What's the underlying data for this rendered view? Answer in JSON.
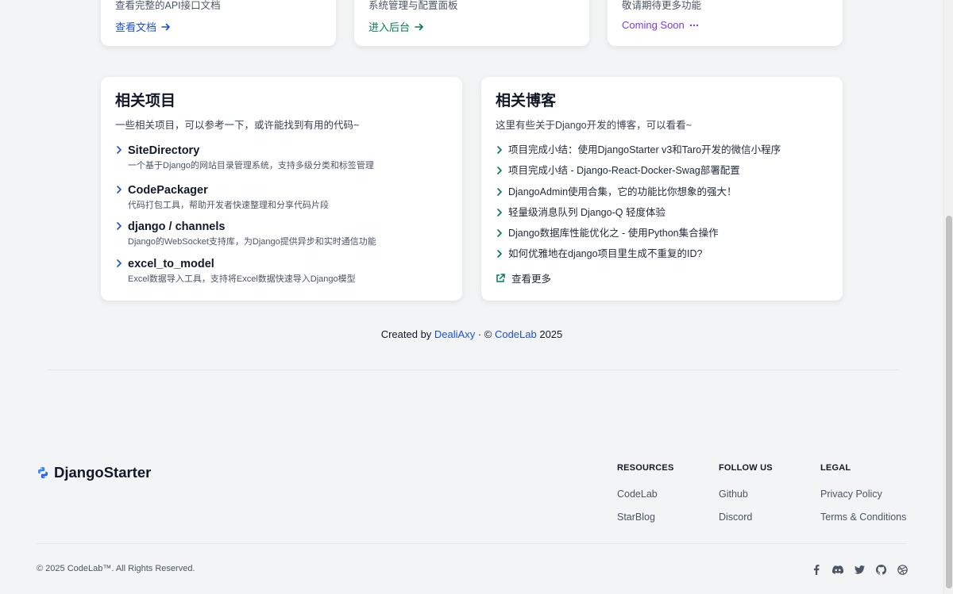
{
  "top_cards": [
    {
      "desc": "查看完整的API接口文档",
      "link": "查看文档"
    },
    {
      "desc": "系统管理与配置面板",
      "link": "进入后台"
    },
    {
      "desc": "敬请期待更多功能",
      "link": "Coming Soon"
    }
  ],
  "projects": {
    "title": "相关项目",
    "subtitle": "一些相关项目，可以参考一下，或许能找到有用的代码~",
    "items": [
      {
        "name": "SiteDirectory",
        "desc": "一个基于Django的网站目录管理系统，支持多级分类和标签管理"
      },
      {
        "name": "CodePackager",
        "desc": "代码打包工具，帮助开发者快速整理和分享代码片段"
      },
      {
        "name": "django / channels",
        "desc": "Django的WebSocket支持库，为Django提供异步和实时通信功能"
      },
      {
        "name": "excel_to_model",
        "desc": "Excel数据导入工具，支持将Excel数据快速导入Django模型"
      }
    ]
  },
  "blogs": {
    "title": "相关博客",
    "subtitle": "这里有些关于Django开发的博客，可以看看~",
    "items": [
      "项目完成小结：使用DjangoStarter v3和Taro开发的微信小程序",
      "项目完成小结 - Django-React-Docker-Swag部署配置",
      "DjangoAdmin使用合集，它的功能比你想象的强大！",
      "轻量级消息队列 Django-Q 轻度体验",
      "Django数据库性能优化之 - 使用Python集合操作",
      "如何优雅地在django项目里生成不重复的ID?"
    ],
    "more": "查看更多"
  },
  "credit": {
    "prefix": "Created by ",
    "author": "DealiAxy",
    "middle": " · © ",
    "org": "CodeLab",
    "year": " 2025"
  },
  "footer": {
    "brand": "DjangoStarter",
    "columns": [
      {
        "title": "RESOURCES",
        "links": [
          "CodeLab",
          "StarBlog"
        ]
      },
      {
        "title": "FOLLOW US",
        "links": [
          "Github",
          "Discord"
        ]
      },
      {
        "title": "LEGAL",
        "links": [
          "Privacy Policy",
          "Terms & Conditions"
        ]
      }
    ],
    "copyright": "© 2025 CodeLab™. All Rights Reserved.",
    "social_icons": [
      "facebook-icon",
      "discord-icon",
      "twitter-icon",
      "github-icon",
      "dribbble-icon"
    ]
  },
  "colors": {
    "blue": "#1d4ed8",
    "green": "#047857",
    "purple": "#7c3aed",
    "chevron": "#047857"
  }
}
